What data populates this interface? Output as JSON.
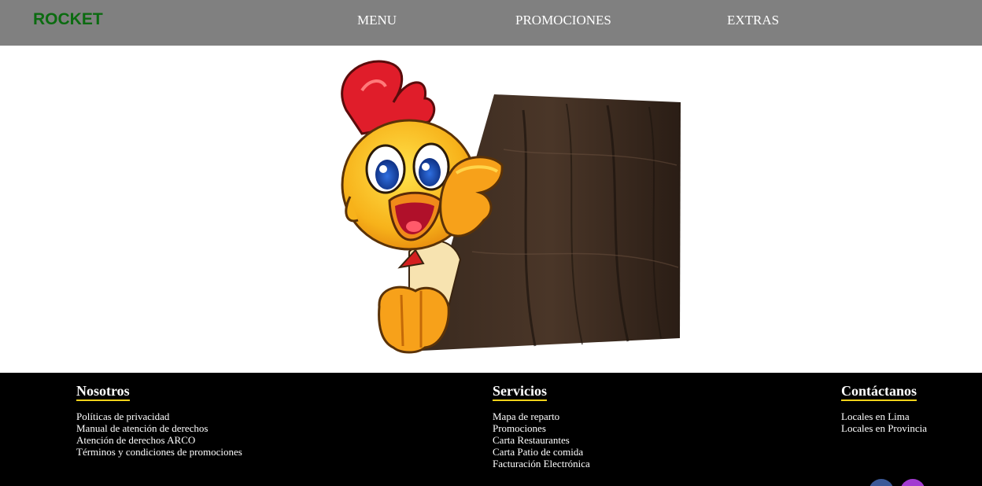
{
  "header": {
    "brand": "ROCKET",
    "nav": [
      {
        "label": "MENU"
      },
      {
        "label": "PROMOCIONES"
      },
      {
        "label": "EXTRAS"
      }
    ]
  },
  "hero": {
    "image_subject": "cartoon chicken mascot peeking from behind a wooden plank"
  },
  "footer": {
    "columns": [
      {
        "heading": "Nosotros",
        "links": [
          "Políticas de privacidad",
          "Manual de atención de derechos",
          "Atención de derechos ARCO",
          "Términos y condiciones de promociones"
        ]
      },
      {
        "heading": "Servicios",
        "links": [
          "Mapa de reparto",
          "Promociones",
          "Carta Restaurantes",
          "Carta Patio de comida",
          "Facturación Electrónica"
        ]
      },
      {
        "heading": "Contáctanos",
        "links": [
          "Locales en Lima",
          "Locales en Provincia"
        ]
      }
    ],
    "social_icons": [
      "facebook-icon",
      "instagram-icon"
    ]
  },
  "colors": {
    "header_bg": "#808080",
    "brand": "#0b6b10",
    "footer_bg": "#000000",
    "heading_underline": "#f2d21a"
  }
}
